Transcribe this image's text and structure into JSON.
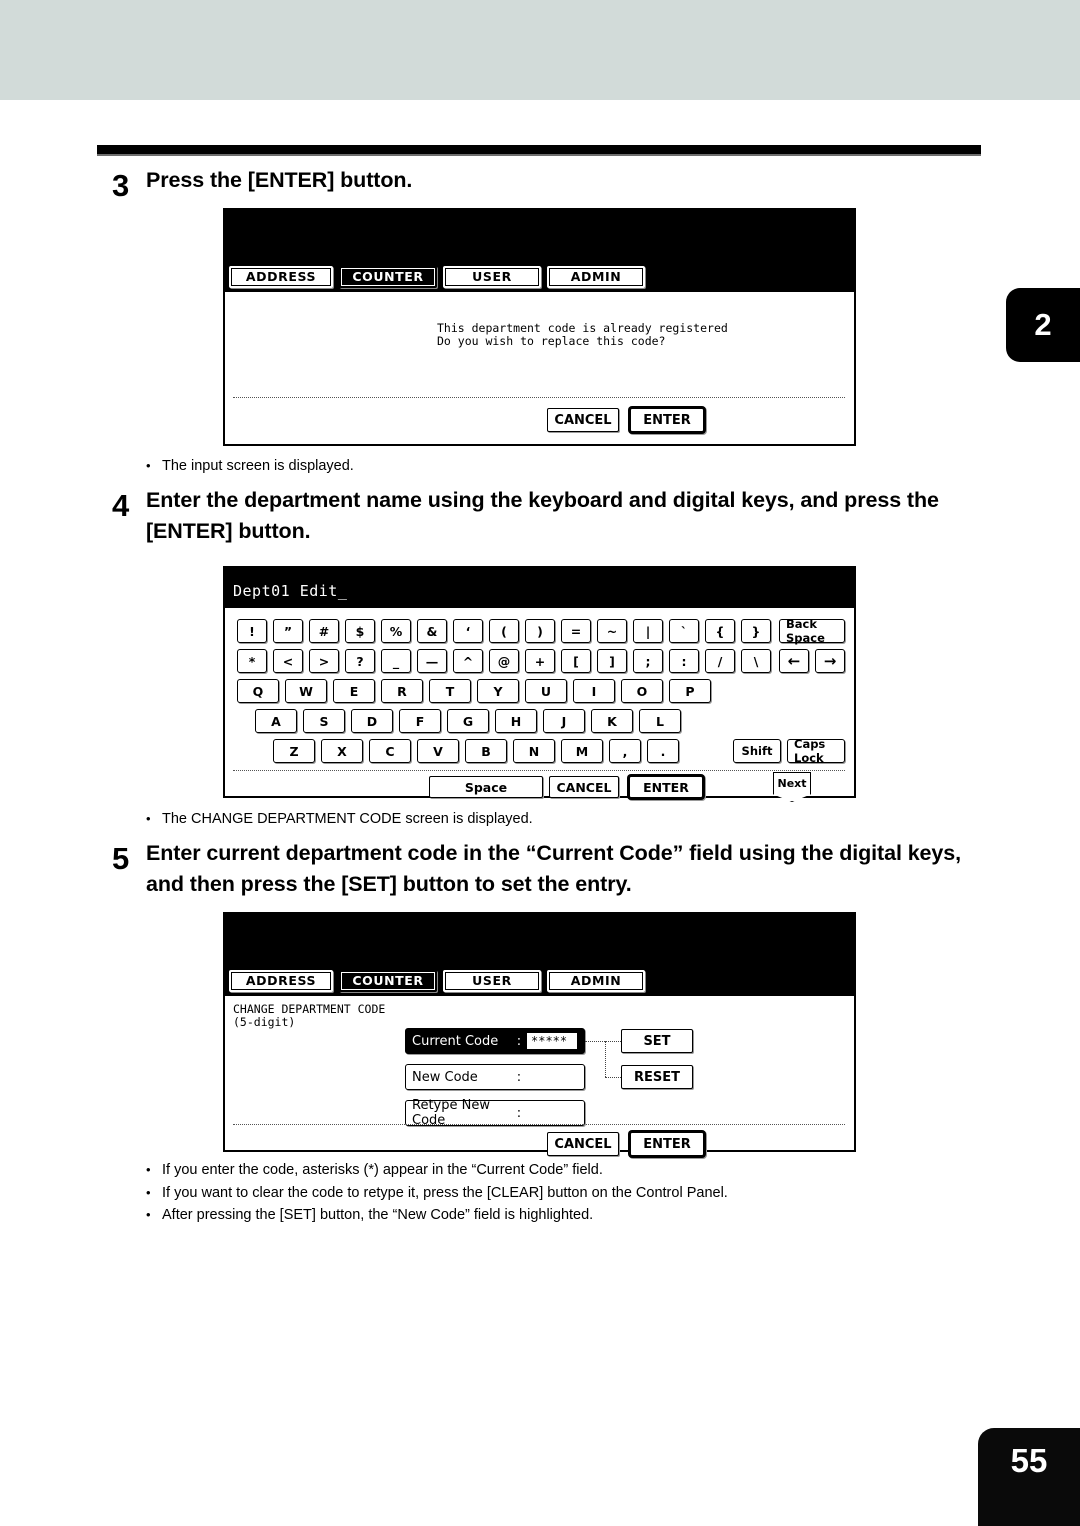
{
  "page": {
    "chapter_tab": "2",
    "page_number": "55"
  },
  "steps": [
    {
      "number": "3",
      "text": "Press the [ENTER] button."
    },
    {
      "number": "4",
      "text": "Enter the department name using the keyboard and digital keys, and press the [ENTER] button."
    },
    {
      "number": "5",
      "text": "Enter current department code in the “Current Code” field using the digital keys, and then press the [SET] button to set the entry."
    }
  ],
  "notes": {
    "after_step3": "The input screen is displayed.",
    "after_step4": "The CHANGE DEPARTMENT CODE screen is displayed.",
    "after_step5": [
      "If you enter the code, asterisks (*) appear in the “Current Code” field.",
      "If you want to clear the code to retype it, press the [CLEAR] button on the Control Panel.",
      "After pressing the [SET] button, the “New Code” field is highlighted."
    ]
  },
  "screen_confirm": {
    "tabs": [
      {
        "label": "ADDRESS",
        "selected": false
      },
      {
        "label": "COUNTER",
        "selected": true
      },
      {
        "label": "USER",
        "selected": false
      },
      {
        "label": "ADMIN",
        "selected": false
      }
    ],
    "message_line1": "This department code is already registered",
    "message_line2": "Do you wish to replace this code?",
    "cancel_label": "CANCEL",
    "enter_label": "ENTER"
  },
  "screen_keyboard": {
    "title": "Dept01 Edit_",
    "row_symbols1": [
      "!",
      "”",
      "#",
      "$",
      "%",
      "&",
      "‘",
      "(",
      ")",
      "=",
      "~",
      "|",
      "`",
      "{",
      "}"
    ],
    "backspace_label": "Back Space",
    "row_symbols2": [
      "*",
      "<",
      ">",
      "?",
      "_",
      "—",
      "^",
      "@",
      "+",
      "[",
      "]",
      ";",
      ":",
      "/",
      "\\"
    ],
    "arrow_left": "←",
    "arrow_right": "→",
    "row_q": [
      "Q",
      "W",
      "E",
      "R",
      "T",
      "Y",
      "U",
      "I",
      "O",
      "P"
    ],
    "row_a": [
      "A",
      "S",
      "D",
      "F",
      "G",
      "H",
      "J",
      "K",
      "L"
    ],
    "row_z": [
      "Z",
      "X",
      "C",
      "V",
      "B",
      "N",
      "M",
      ",",
      "."
    ],
    "shift_label": "Shift",
    "caps_label": "Caps Lock",
    "space_label": "Space",
    "cancel_label": "CANCEL",
    "enter_label": "ENTER",
    "next_label": "Next"
  },
  "screen_change_code": {
    "tabs": [
      {
        "label": "ADDRESS",
        "selected": false
      },
      {
        "label": "COUNTER",
        "selected": true
      },
      {
        "label": "USER",
        "selected": false
      },
      {
        "label": "ADMIN",
        "selected": false
      }
    ],
    "heading_line1": "CHANGE DEPARTMENT CODE",
    "heading_line2": "(5-digit)",
    "fields": [
      {
        "label": "Current Code",
        "colon": ":",
        "value": "*****",
        "highlighted": true
      },
      {
        "label": "New Code",
        "colon": ":",
        "value": "",
        "highlighted": false
      },
      {
        "label": "Retype New Code",
        "colon": ":",
        "value": "",
        "highlighted": false
      }
    ],
    "set_label": "SET",
    "reset_label": "RESET",
    "cancel_label": "CANCEL",
    "enter_label": "ENTER"
  }
}
